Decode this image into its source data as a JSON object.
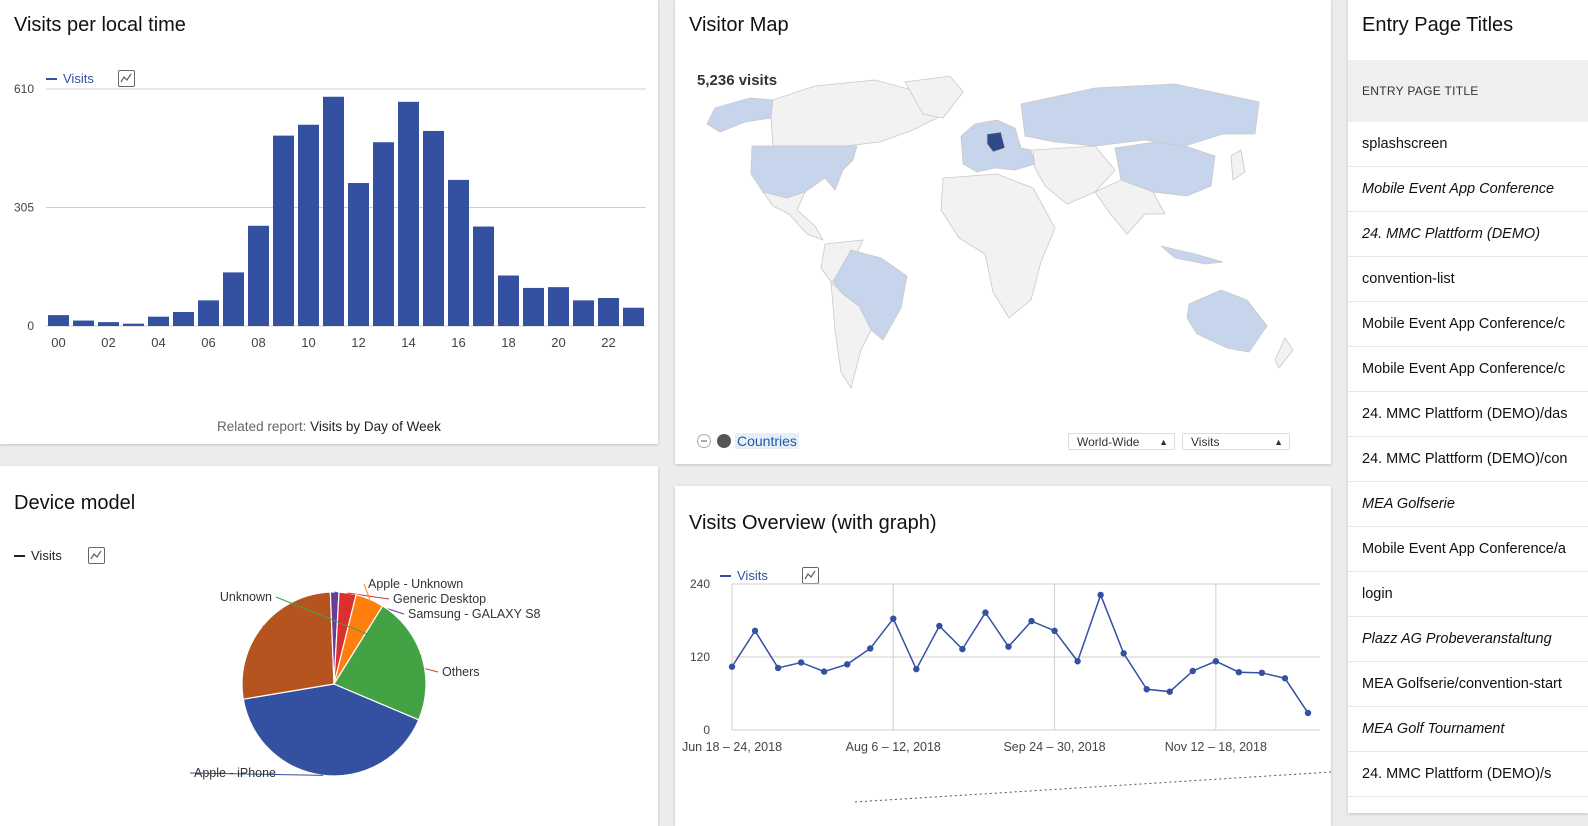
{
  "visits_local_time": {
    "title": "Visits per local time",
    "legend_label": "Visits",
    "related_prefix": "Related report:",
    "related_link": "Visits by Day of Week"
  },
  "visitor_map": {
    "title": "Visitor Map",
    "total": "5,236 visits",
    "countries_link": "Countries",
    "region_select": "World-Wide",
    "metric_select": "Visits"
  },
  "entry_pages": {
    "title": "Entry Page Titles",
    "column_header": "ENTRY PAGE TITLE",
    "rows": [
      {
        "label": "splashscreen",
        "italic": false
      },
      {
        "label": "Mobile Event App Conference",
        "italic": true
      },
      {
        "label": "24. MMC Plattform (DEMO)",
        "italic": true
      },
      {
        "label": "convention-list",
        "italic": false
      },
      {
        "label": "Mobile Event App Conference/c",
        "italic": false
      },
      {
        "label": "Mobile Event App Conference/c",
        "italic": false
      },
      {
        "label": "24. MMC Plattform (DEMO)/das",
        "italic": false
      },
      {
        "label": "24. MMC Plattform (DEMO)/con",
        "italic": false
      },
      {
        "label": "MEA Golfserie",
        "italic": true
      },
      {
        "label": "Mobile Event App Conference/a",
        "italic": false
      },
      {
        "label": "login",
        "italic": false
      },
      {
        "label": "Plazz AG Probeveranstaltung",
        "italic": true
      },
      {
        "label": "MEA Golfserie/convention-start",
        "italic": false
      },
      {
        "label": "MEA Golf Tournament",
        "italic": true
      },
      {
        "label": "24. MMC Plattform (DEMO)/s",
        "italic": false
      }
    ]
  },
  "device_model": {
    "title": "Device model",
    "legend_label": "Visits"
  },
  "visits_overview": {
    "title": "Visits Overview (with graph)",
    "legend_label": "Visits"
  },
  "colors": {
    "accent": "#3450a1",
    "link": "#1e5aa8",
    "map_visited": "#c7d5ec",
    "map_top": "#2f4a8a",
    "map_land": "#f2f2f2"
  },
  "chart_data": [
    {
      "type": "bar",
      "title": "Visits per local time",
      "categories": [
        "00",
        "01",
        "02",
        "03",
        "04",
        "05",
        "06",
        "07",
        "08",
        "09",
        "10",
        "11",
        "12",
        "13",
        "14",
        "15",
        "16",
        "17",
        "18",
        "19",
        "20",
        "21",
        "22",
        "23"
      ],
      "xtick_labels": [
        "00",
        "02",
        "04",
        "06",
        "08",
        "10",
        "12",
        "14",
        "16",
        "18",
        "20",
        "22"
      ],
      "series": [
        {
          "name": "Visits",
          "values": [
            28,
            14,
            10,
            6,
            24,
            36,
            66,
            138,
            258,
            490,
            518,
            590,
            368,
            473,
            577,
            502,
            376,
            256,
            130,
            98,
            100,
            66,
            72,
            47
          ]
        }
      ],
      "yticks": [
        0,
        305,
        610
      ],
      "ylim": [
        0,
        610
      ]
    },
    {
      "type": "pie",
      "title": "Device model",
      "series": [
        {
          "name": "Visits"
        }
      ],
      "slices": [
        {
          "label": "Apple - iPhone",
          "value": 41,
          "color": "#3450a1"
        },
        {
          "label": "Others",
          "value": 27,
          "color": "#b5541f"
        },
        {
          "label": "Samsung - GALAXY S8",
          "value": 1.5,
          "color": "#6a3d9a"
        },
        {
          "label": "Generic Desktop",
          "value": 3,
          "color": "#dc2f2f"
        },
        {
          "label": "Apple - Unknown",
          "value": 5,
          "color": "#ff7f0e"
        },
        {
          "label": "Unknown",
          "value": 22.5,
          "color": "#43a243"
        }
      ]
    },
    {
      "type": "line",
      "title": "Visits Overview (with graph)",
      "xtick_labels": [
        "Jun 18 – 24, 2018",
        "Aug 6 – 12, 2018",
        "Sep 24 – 30, 2018",
        "Nov 12 – 18, 2018"
      ],
      "xtick_positions": [
        0,
        7,
        14,
        21
      ],
      "series": [
        {
          "name": "Visits",
          "values": [
            104,
            163,
            102,
            111,
            96,
            108,
            134,
            183,
            100,
            171,
            133,
            193,
            137,
            179,
            163,
            113,
            222,
            126,
            67,
            63,
            97,
            113,
            95,
            94,
            85,
            28
          ]
        }
      ],
      "yticks": [
        0,
        120,
        240
      ],
      "ylim": [
        0,
        240
      ]
    }
  ]
}
